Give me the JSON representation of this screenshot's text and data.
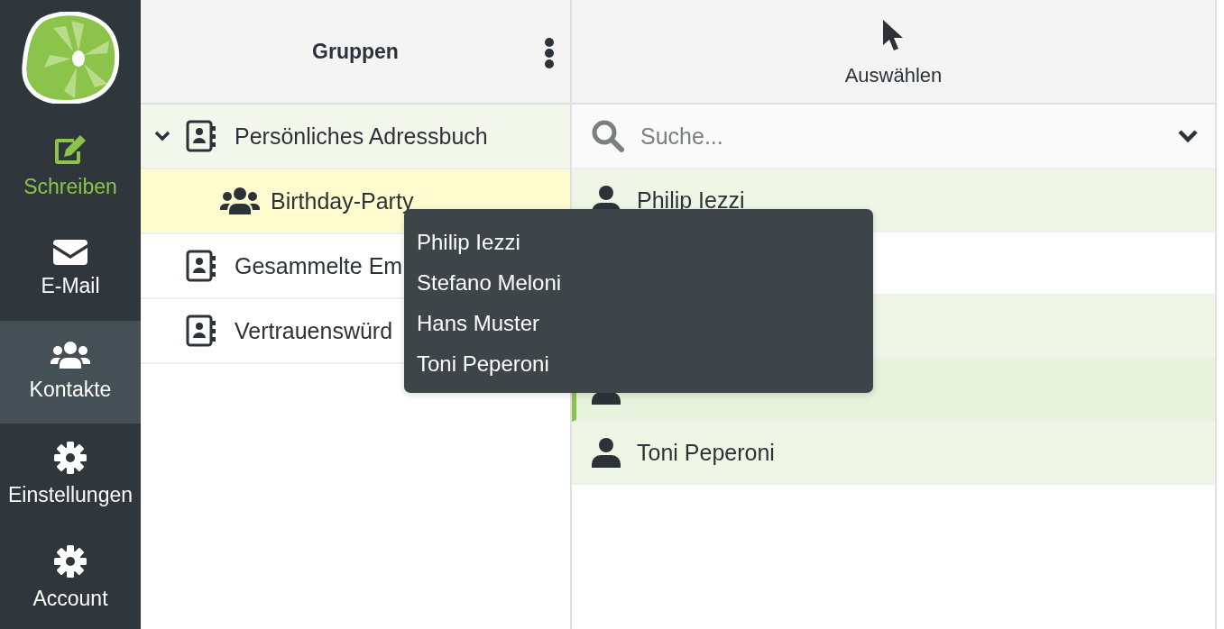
{
  "sidebar": {
    "items": [
      {
        "kind": "compose",
        "label": "Schreiben",
        "selected": false
      },
      {
        "kind": "mail",
        "label": "E-Mail",
        "selected": false
      },
      {
        "kind": "contacts",
        "label": "Kontakte",
        "selected": true
      },
      {
        "kind": "settings",
        "label": "Einstellungen",
        "selected": false
      },
      {
        "kind": "account",
        "label": "Account",
        "selected": false
      }
    ]
  },
  "groups": {
    "title": "Gruppen",
    "items": [
      {
        "kind": "addressbook",
        "label": "Persönliches Adressbuch",
        "selected": true,
        "hovered": false,
        "expanded": true,
        "children": [
          {
            "kind": "group",
            "label": "Birthday-Party",
            "selected": false,
            "hovered": true
          }
        ]
      },
      {
        "kind": "addressbook",
        "label": "Gesammelte Em",
        "selected": false,
        "hovered": false
      },
      {
        "kind": "addressbook",
        "label": "Vertrauenswürd",
        "selected": false,
        "hovered": false
      }
    ]
  },
  "contacts": {
    "select_button": {
      "label": "Auswählen"
    },
    "search": {
      "placeholder": "Suche..."
    },
    "items": [
      {
        "kind": "full",
        "name": "Philip Iezzi",
        "selected": true,
        "focused": false
      },
      {
        "kind": "covered",
        "selected": false,
        "focused": false
      },
      {
        "kind": "covered",
        "selected": true,
        "focused": false
      },
      {
        "kind": "partly_covered",
        "selected": true,
        "focused": true
      },
      {
        "kind": "full",
        "name": "Toni Peperoni",
        "selected": true,
        "focused": false
      }
    ]
  },
  "tooltip": {
    "lines": [
      "Philip Iezzi",
      "Stefano Meloni",
      "Hans Muster",
      "Toni Peperoni"
    ]
  }
}
